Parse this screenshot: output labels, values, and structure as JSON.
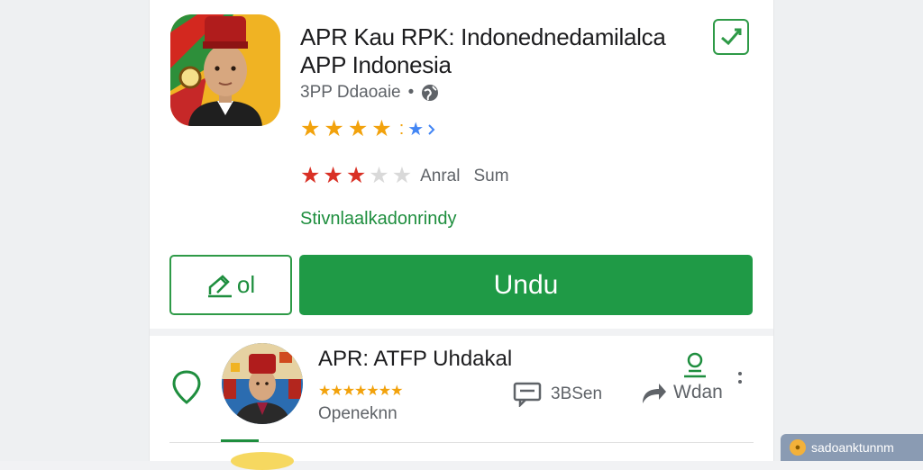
{
  "app": {
    "title_line1": "APR Kau RPK: Indonednedamilalca",
    "title_line2": "APP Indonesia",
    "developer": "3PP Ddaoaie",
    "dev_separator": "•",
    "rating_label": "Anral",
    "rating_label2": "Sum",
    "green_link": "Stivnlaalkadonrindy",
    "secondary_button_label": "ol",
    "install_button_label": "Undu",
    "stars_row1_filled": 4,
    "stars_row2_filled": 3,
    "stars_row2_total": 5
  },
  "recommended": {
    "title": "APR: ATFP Uhdakal",
    "stars": "★★★★★★★",
    "subtitle": "Openeknn",
    "comment_label": "3BSen",
    "share_label": "Wdan"
  },
  "watermark": {
    "text": "sadoanktunnm"
  },
  "colors": {
    "brand_green": "#1f9a46",
    "star_gold": "#f2a20c",
    "star_red": "#d93025",
    "star_blue": "#4285f4"
  },
  "icons": [
    "check-icon",
    "globe-icon",
    "chevron-right-icon",
    "pencil-icon",
    "location-pin-icon",
    "comment-icon",
    "share-icon",
    "person-icon",
    "more-vert-icon"
  ]
}
